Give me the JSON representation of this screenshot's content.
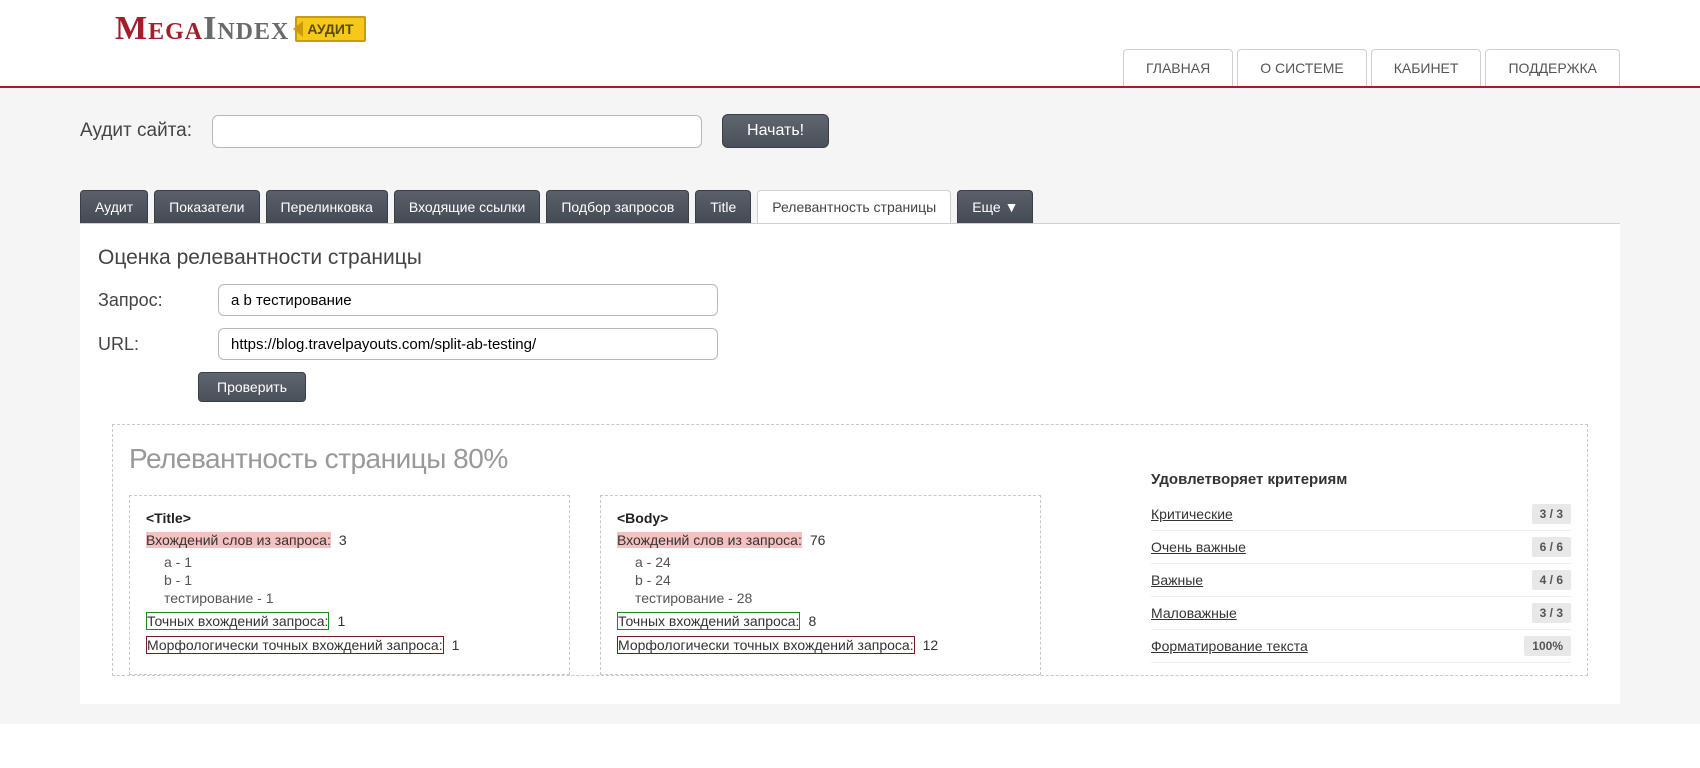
{
  "logo": {
    "part1": "Mega",
    "part2": "Index",
    "badge": "АУДИТ"
  },
  "topnav": [
    "ГЛАВНАЯ",
    "О СИСТЕМЕ",
    "КАБИНЕТ",
    "ПОДДЕРЖКА"
  ],
  "audit": {
    "label": "Аудит сайта:",
    "value": "",
    "start": "Начать!"
  },
  "tabs": {
    "items": [
      "Аудит",
      "Показатели",
      "Перелинковка",
      "Входящие ссылки",
      "Подбор запросов",
      "Title",
      "Релевантность страницы",
      "Еще ▼"
    ],
    "activeIndex": 6
  },
  "panel": {
    "title": "Оценка релевантности страницы",
    "queryLabel": "Запрос:",
    "queryValue": "a b тестирование",
    "urlLabel": "URL:",
    "urlValue": "https://blog.travelpayouts.com/split-ab-testing/",
    "checkBtn": "Проверить"
  },
  "relevance": {
    "titlePrefix": "Релевантность страницы ",
    "percent": "80%"
  },
  "cards": {
    "title": {
      "head": "<Title>",
      "wordsLabel": "Вхождений слов из запроса:",
      "wordsCount": "3",
      "breakdown": [
        "a - 1",
        "b - 1",
        "тестирование - 1"
      ],
      "exactLabel": "Точных вхождений запроса:",
      "exactCount": "1",
      "morphLabel": "Морфологически точных вхождений запроса:",
      "morphCount": "1"
    },
    "body": {
      "head": "<Body>",
      "wordsLabel": "Вхождений слов из запроса:",
      "wordsCount": "76",
      "breakdown": [
        "a - 24",
        "b - 24",
        "тестирование - 28"
      ],
      "exactLabel": "Точных вхождений запроса:",
      "exactCount": "8",
      "morphLabel": "Морфологически точных вхождений запроса:",
      "morphCount": "12"
    }
  },
  "criteria": {
    "title": "Удовлетворяет критериям",
    "rows": [
      {
        "label": "Критические",
        "value": "3 / 3"
      },
      {
        "label": "Очень важные",
        "value": "6 / 6"
      },
      {
        "label": "Важные",
        "value": "4 / 6"
      },
      {
        "label": "Маловажные",
        "value": "3 / 3"
      },
      {
        "label": "Форматирование текста",
        "value": "100%"
      }
    ]
  }
}
